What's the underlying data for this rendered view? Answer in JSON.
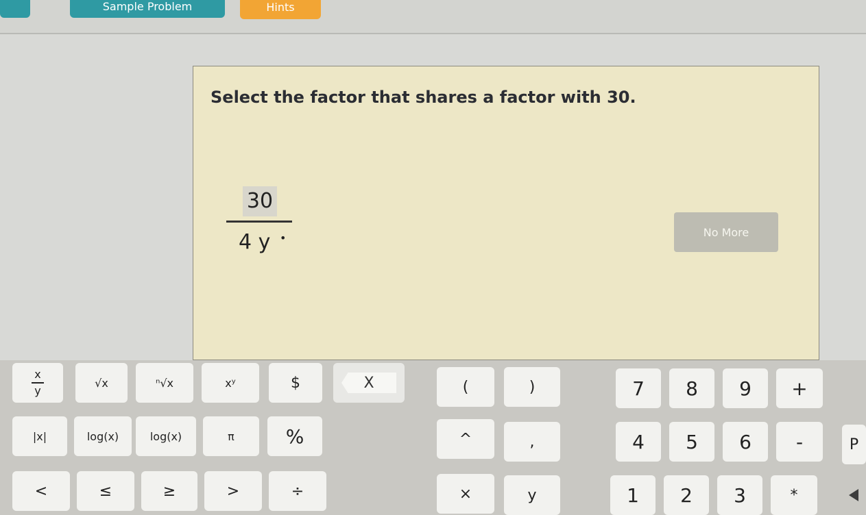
{
  "tabs": [
    {
      "label": "",
      "kind": "teal"
    },
    {
      "label": "Sample Problem",
      "kind": "teal"
    },
    {
      "label": "Hints",
      "kind": "orange"
    }
  ],
  "question": {
    "prompt": "Select the factor that shares a factor with 30.",
    "fraction": {
      "numerator": "30",
      "denominator": "4 y",
      "superscript_marker": "•"
    }
  },
  "no_more_button": {
    "label": "No More"
  },
  "keypad": {
    "row1": [
      "x/y",
      "√x",
      "ⁿ√x",
      "xʸ",
      "$",
      "X",
      "(",
      ")",
      "7",
      "8",
      "9",
      "+"
    ],
    "row2": [
      "|x|",
      "log(x)",
      "log(x)",
      "π",
      "%",
      "^",
      ",",
      "4",
      "5",
      "6",
      "-",
      "P"
    ],
    "row3": [
      "<",
      "≤",
      "≥",
      ">",
      "÷",
      "×",
      "y",
      "1",
      "2",
      "3",
      "*",
      "◀"
    ]
  },
  "colors": {
    "panel": "#ede7c6",
    "teal_tab": "#2f9aa3",
    "orange_tab": "#f2a534",
    "keypad_bg": "#c9c8c3"
  }
}
